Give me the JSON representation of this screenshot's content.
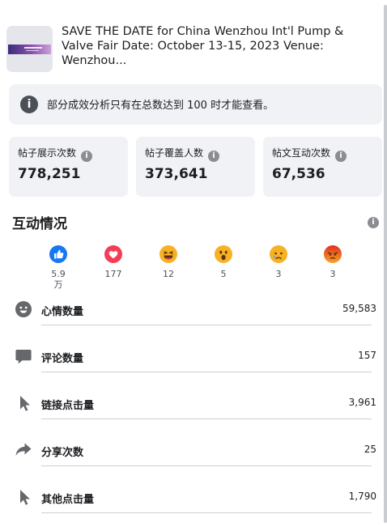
{
  "post": {
    "title": "SAVE THE DATE for China Wenzhou Int'l Pump & Valve Fair Date: October 13-15, 2023 Venue: Wenzhou..."
  },
  "notice": {
    "icon": "info-icon",
    "text": "部分成效分析只有在总数达到 100 时才能查看。"
  },
  "stats": [
    {
      "label": "帖子展示次数",
      "value": "778,251"
    },
    {
      "label": "帖子覆盖人数",
      "value": "373,641"
    },
    {
      "label": "帖文互动次数",
      "value": "67,536"
    }
  ],
  "interactions": {
    "title": "互动情况",
    "reactions": [
      {
        "name": "like",
        "icon": "like-icon",
        "count": "5.9\n万",
        "color": "#1877f2"
      },
      {
        "name": "love",
        "icon": "love-icon",
        "count": "177",
        "color": "#f33e58"
      },
      {
        "name": "haha",
        "icon": "haha-icon",
        "count": "12",
        "color": "#f7b125"
      },
      {
        "name": "wow",
        "icon": "wow-icon",
        "count": "5",
        "color": "#f7b125"
      },
      {
        "name": "sad",
        "icon": "sad-icon",
        "count": "3",
        "color": "#f7b125"
      },
      {
        "name": "angry",
        "icon": "angry-icon",
        "count": "3",
        "color": "#e9710f"
      }
    ],
    "metrics": [
      {
        "label": "心情数量",
        "value": "59,583",
        "icon": "smiley-icon"
      },
      {
        "label": "评论数量",
        "value": "157",
        "icon": "comment-icon"
      },
      {
        "label": "链接点击量",
        "value": "3,961",
        "icon": "cursor-icon"
      },
      {
        "label": "分享次数",
        "value": "25",
        "icon": "share-icon"
      },
      {
        "label": "其他点击量",
        "value": "1,790",
        "icon": "cursor-icon"
      }
    ]
  }
}
